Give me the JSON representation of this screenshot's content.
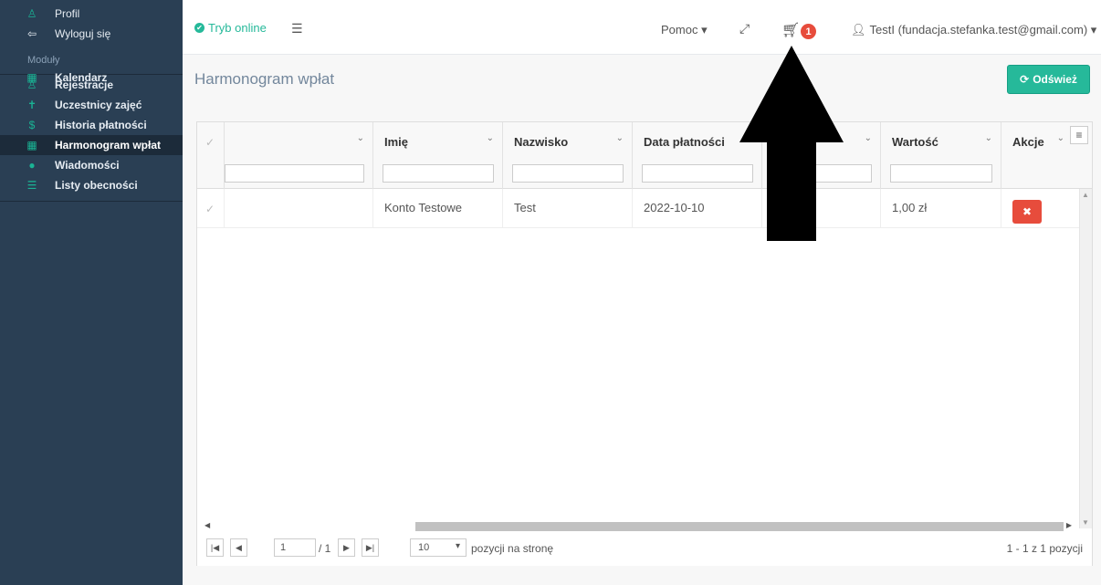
{
  "sidebar": {
    "top_items": [
      {
        "label": "Profil",
        "icon": "user-icon"
      },
      {
        "label": "Wyloguj się",
        "icon": "logout-icon"
      }
    ],
    "section_label": "Moduły",
    "items": [
      {
        "label": "Kalendarz",
        "icon": "calendar-icon"
      },
      {
        "label": "Rejestracje",
        "icon": "user-icon"
      },
      {
        "label": "Uczestnicy zajęć",
        "icon": "person-icon"
      },
      {
        "label": "Historia płatności",
        "icon": "dollar-icon"
      },
      {
        "label": "Harmonogram wpłat",
        "icon": "calendar-icon",
        "active": true
      },
      {
        "label": "Wiadomości",
        "icon": "comments-icon"
      },
      {
        "label": "Listy obecności",
        "icon": "list-icon"
      }
    ]
  },
  "topbar": {
    "online_label": "Tryb online",
    "help_label": "Pomoc ▾",
    "cart_count": "1",
    "user_name": "TestI",
    "user_email": "(fundacja.stefanka.test@gmail.com) ▾"
  },
  "page": {
    "title": "Harmonogram wpłat",
    "refresh_label": "Odśwież"
  },
  "grid": {
    "columns": [
      "",
      "Imię",
      "Nazwisko",
      "Data płatności",
      "",
      "Wartość",
      "Akcje"
    ],
    "rows": [
      {
        "col0": "",
        "imie": "Konto Testowe",
        "nazwisko": "Test",
        "data": "2022-10-10",
        "col4": "",
        "wartosc": "1,00 zł"
      }
    ]
  },
  "pager": {
    "page_value": "1",
    "page_total": "/ 1",
    "page_size": "10",
    "page_size_label": "pozycji na stronę",
    "info": "1 - 1 z 1 pozycji"
  },
  "colors": {
    "sidebar_bg": "#2a3f54",
    "accent_green": "#26b99a",
    "danger_red": "#e74c3c"
  }
}
